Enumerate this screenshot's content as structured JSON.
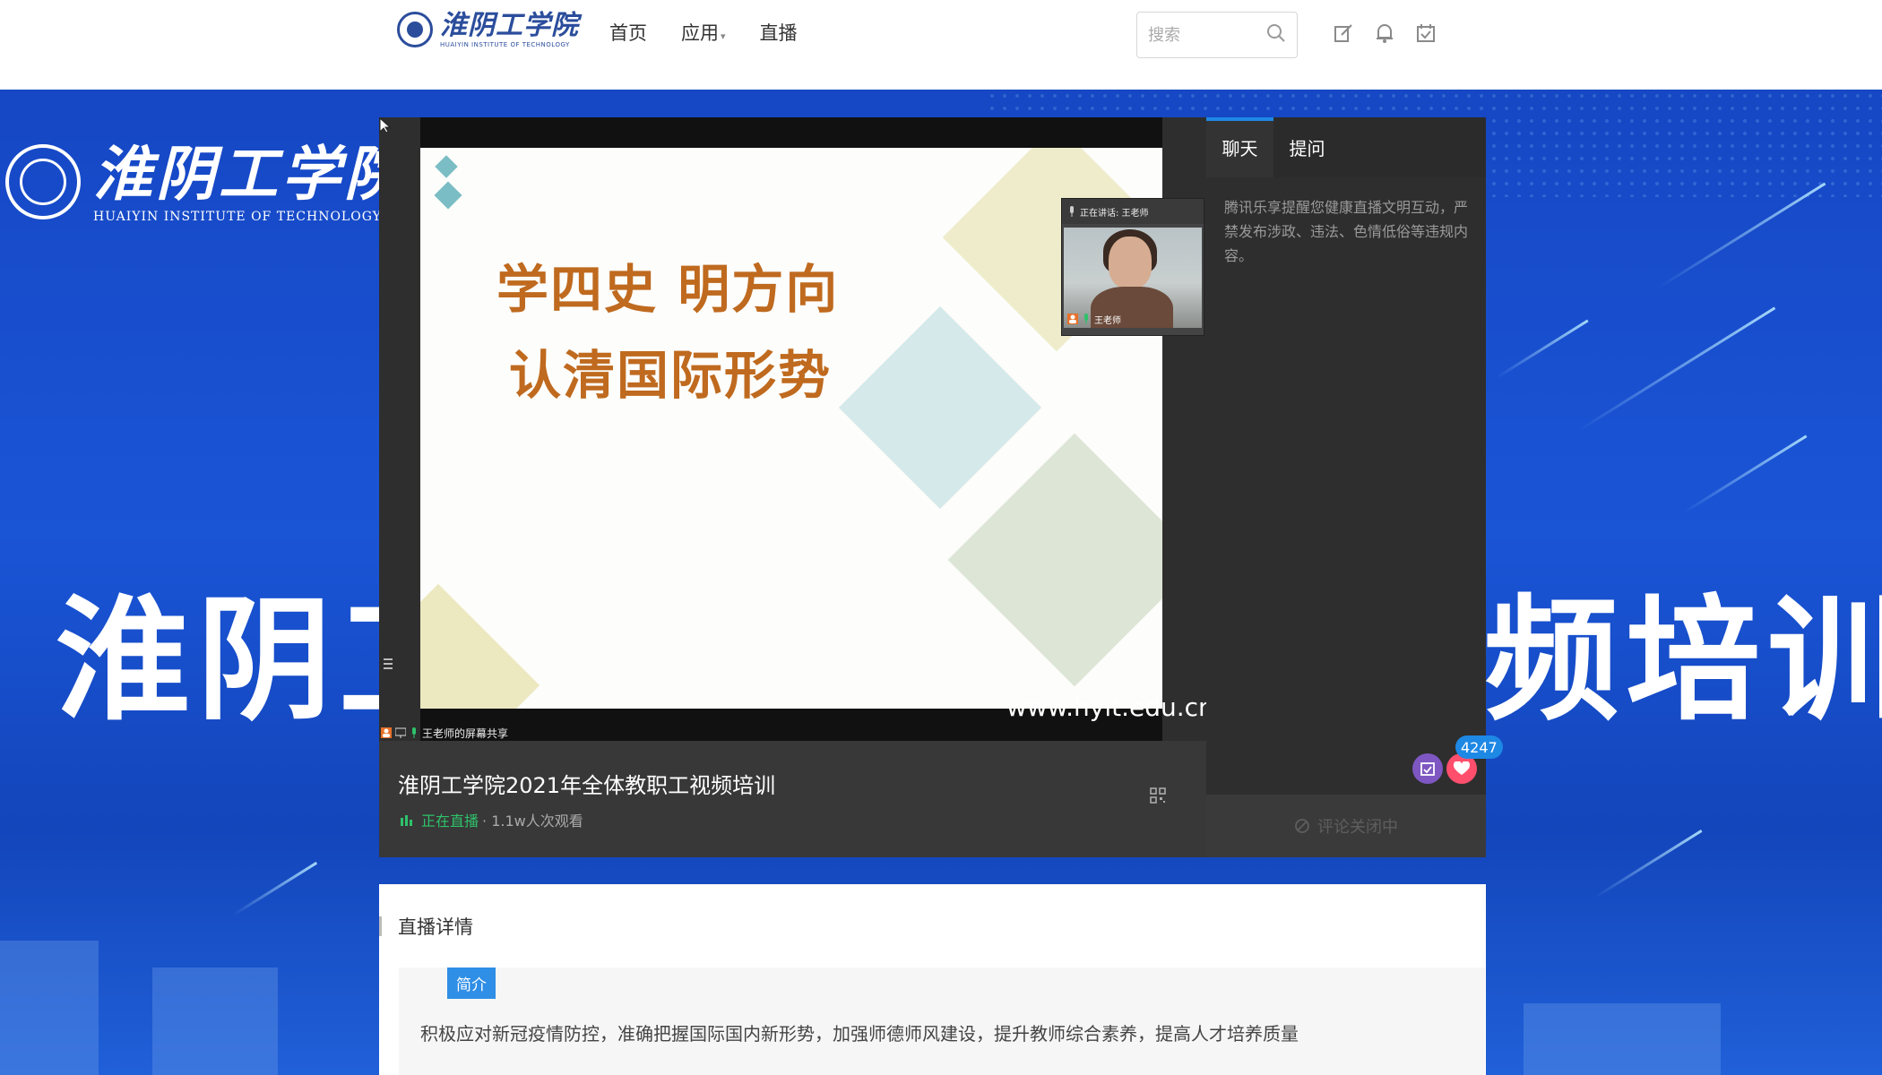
{
  "nav": {
    "logo_cn": "淮阴工学院",
    "logo_en": "HUAIYIN INSTITUTE OF TECHNOLOGY",
    "links": [
      {
        "label": "首页"
      },
      {
        "label": "应用"
      },
      {
        "label": "直播"
      }
    ],
    "search_placeholder": "搜索",
    "icons": [
      "edit-icon",
      "bell-icon",
      "calendar-check-icon"
    ]
  },
  "banner": {
    "logo_cn": "淮阴工学院",
    "logo_en": "HUAIYIN INSTITUTE OF TECHNOLOGY",
    "title_left": "淮阴工",
    "title_right": "频培训"
  },
  "player": {
    "slide_line1": "学四史 明方向",
    "slide_line2": "认清国际形势",
    "watermark": "www.hyit.edu.cn",
    "cam_speaker_label": "正在讲话: 王老师",
    "cam_name": "王老师",
    "share_label": "王老师的屏幕共享",
    "title": "淮阴工学院2021年全体教职工视频培训",
    "live_label": "正在直播",
    "views": "· 1.1w人次观看"
  },
  "chat": {
    "tabs": [
      "聊天",
      "提问"
    ],
    "notice": "腾讯乐享提醒您健康直播文明互动，严禁发布涉政、违法、色情低俗等违规内容。",
    "like_count": "4247",
    "comment_status": "评论关闭中"
  },
  "details": {
    "heading": "直播详情",
    "tab": "简介",
    "intro": "积极应对新冠疫情防控，准确把握国际国内新形势，加强师德师风建设，提升教师综合素养，提高人才培养质量"
  },
  "colors": {
    "banner_blue": "#1a55d6",
    "live_green": "#2ec26a",
    "accent_blue": "#1e88e5",
    "slide_title": "#bf6a1f",
    "heart": "#ff4f6d"
  }
}
